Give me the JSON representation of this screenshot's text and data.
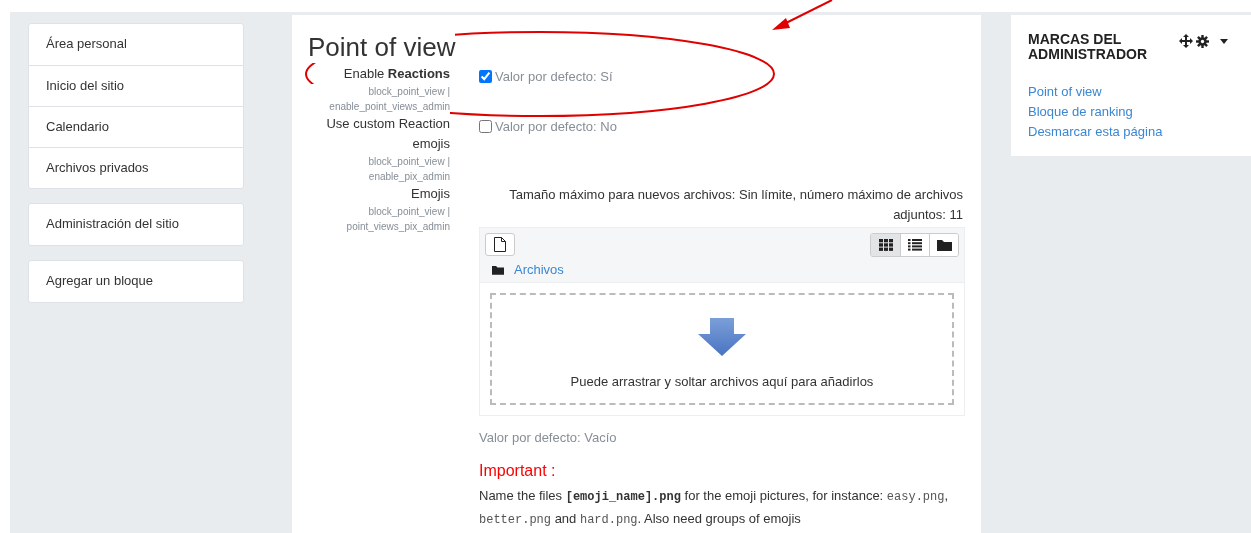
{
  "nav_blocks": [
    {
      "items": [
        {
          "label": "Área personal"
        },
        {
          "label": "Inicio del sitio"
        },
        {
          "label": "Calendario"
        },
        {
          "label": "Archivos privados"
        }
      ]
    },
    {
      "items": [
        {
          "label": "Administración del sitio"
        }
      ]
    },
    {
      "items": [
        {
          "label": "Agregar un bloque"
        }
      ]
    }
  ],
  "main": {
    "title": "Point of view",
    "settings": [
      {
        "kind": "checkbox",
        "label": "Enable **Reactions**",
        "hint": "block_point_view | enable_point_views_admin",
        "checked": true,
        "default": "Valor por defecto: Sí"
      },
      {
        "kind": "checkbox",
        "label": "Use custom Reaction emojis",
        "hint": "block_point_view | enable_pix_admin",
        "checked": false,
        "default": "Valor por defecto: No"
      },
      {
        "kind": "filemanager",
        "label": "Emojis",
        "hint": "block_point_view | point_views_pix_admin",
        "limits": "Tamaño máximo para nuevos archivos: Sin límite, número máximo de archivos adjuntos: 11",
        "path": "Archivos",
        "view_modes": [
          {
            "kind": "icons",
            "selected": true
          },
          {
            "kind": "list",
            "selected": false
          },
          {
            "kind": "tree",
            "selected": false
          }
        ],
        "drop_hint": "Puede arrastrar y soltar archivos aquí para añadirlos",
        "default": "Valor por defecto: Vacío"
      }
    ],
    "important_title": "Important :",
    "important_text": [
      {
        "kind": "text",
        "text": "Name the files "
      },
      {
        "kind": "code",
        "bold": true,
        "text": "[emoji_name].png"
      },
      {
        "kind": "text",
        "text": " for the emoji pictures, for instance: "
      },
      {
        "kind": "code",
        "bold": false,
        "text": "easy.png"
      },
      {
        "kind": "text",
        "text": ", "
      },
      {
        "kind": "code",
        "bold": false,
        "text": "better.png"
      },
      {
        "kind": "text",
        "text": " and "
      },
      {
        "kind": "code",
        "bold": false,
        "text": "hard.png"
      },
      {
        "kind": "text",
        "text": ". Also need groups of emojis"
      }
    ]
  },
  "admin_block": {
    "title": "MARCAS DEL ADMINISTRADOR",
    "links": [
      "Point of view",
      "Bloque de ranking",
      "Desmarcar esta página"
    ]
  },
  "annotation_ellipse": {
    "color": "#e00000"
  },
  "annotation_arrow": {
    "color": "#e00000"
  }
}
